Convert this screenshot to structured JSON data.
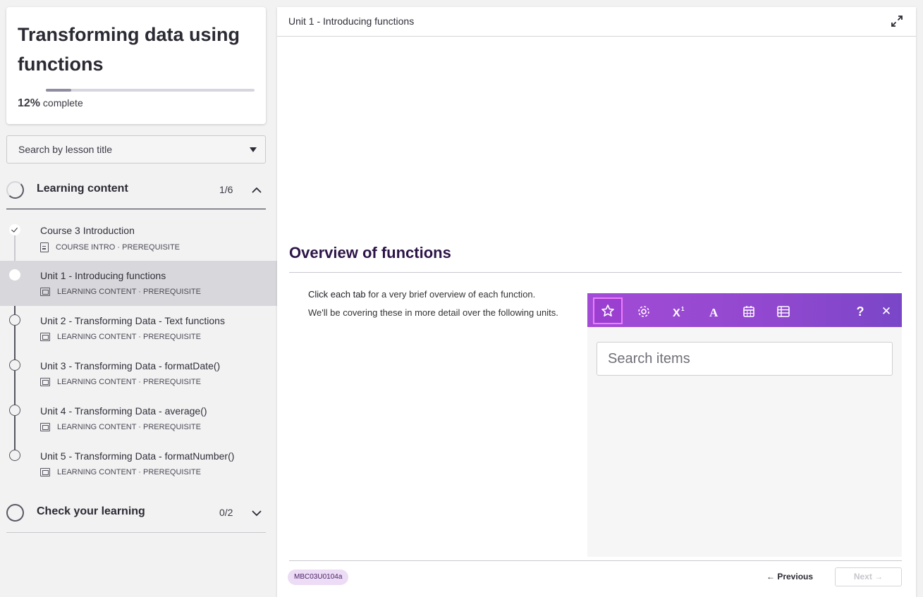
{
  "course": {
    "title": "Transforming data using functions",
    "progress_percent": "12%",
    "progress_fraction": 0.12,
    "progress_suffix": "complete"
  },
  "search": {
    "placeholder": "Search by lesson title"
  },
  "sections": [
    {
      "title": "Learning content",
      "count": "1/6",
      "expanded": true
    },
    {
      "title": "Check your learning",
      "count": "0/2",
      "expanded": false
    }
  ],
  "lessons": [
    {
      "title": "Course 3 Introduction",
      "meta": "COURSE INTRO · PREREQUISITE",
      "status": "done",
      "icon": "document-icon"
    },
    {
      "title": "Unit 1 - Introducing functions",
      "meta": "LEARNING CONTENT · PREREQUISITE",
      "status": "active",
      "icon": "presentation-icon"
    },
    {
      "title": "Unit 2 - Transforming Data - Text functions",
      "meta": "LEARNING CONTENT · PREREQUISITE",
      "status": "todo",
      "icon": "presentation-icon"
    },
    {
      "title": "Unit 3 - Transforming Data - formatDate()",
      "meta": "LEARNING CONTENT · PREREQUISITE",
      "status": "todo",
      "icon": "presentation-icon"
    },
    {
      "title": "Unit 4 - Transforming Data - average()",
      "meta": "LEARNING CONTENT · PREREQUISITE",
      "status": "todo",
      "icon": "presentation-icon"
    },
    {
      "title": "Unit 5 - Transforming Data - formatNumber()",
      "meta": "LEARNING CONTENT · PREREQUISITE",
      "status": "todo",
      "icon": "presentation-icon"
    }
  ],
  "main": {
    "breadcrumb": "Unit 1 - Introducing functions",
    "overview_title": "Overview of functions",
    "intro_strong": "Click each tab",
    "intro_rest": " for a very brief overview of each function.",
    "intro_p2": "We'll be covering these in more detail over the following units.",
    "widget": {
      "tools": [
        "star-icon",
        "gear-icon",
        "superscript-icon",
        "font-icon",
        "calendar-icon",
        "table-icon"
      ],
      "help_label": "?",
      "close_label": "✕",
      "search_placeholder": "Search items",
      "toolbar_color": "#9048cf"
    },
    "footer": {
      "code": "MBC03U0104a",
      "previous_label": "← Previous",
      "next_label": "Next →"
    }
  }
}
